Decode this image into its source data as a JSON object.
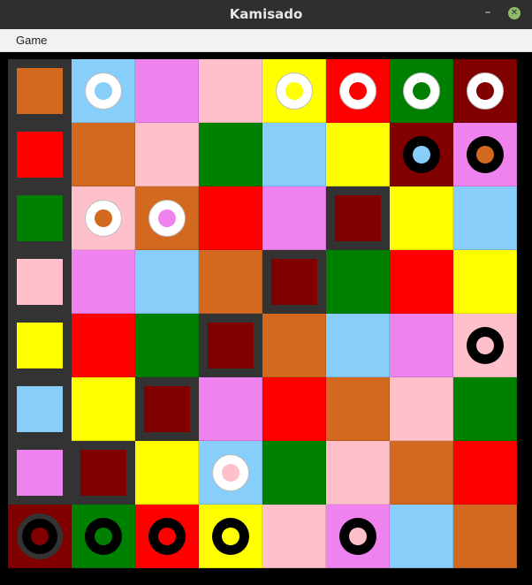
{
  "window": {
    "title": "Kamisado"
  },
  "titlebar": {
    "minimize_glyph": "–",
    "close_glyph": "✕"
  },
  "menu": {
    "items": [
      "Game"
    ]
  },
  "colors": {
    "orange": "#d2691e",
    "blue": "#87cefa",
    "violet": "#ee82ee",
    "pink": "#ffc0cb",
    "yellow": "#ffff00",
    "red": "#ff0000",
    "green": "#008000",
    "brown": "#800000",
    "frame": "#333333"
  },
  "board": {
    "rows": [
      [
        "orange",
        "blue",
        "violet",
        "pink",
        "yellow",
        "red",
        "green",
        "brown"
      ],
      [
        "red",
        "orange",
        "pink",
        "green",
        "blue",
        "yellow",
        "brown",
        "violet"
      ],
      [
        "green",
        "pink",
        "orange",
        "red",
        "violet",
        "brown",
        "yellow",
        "blue"
      ],
      [
        "pink",
        "violet",
        "blue",
        "orange",
        "brown",
        "green",
        "red",
        "yellow"
      ],
      [
        "yellow",
        "red",
        "green",
        "brown",
        "orange",
        "blue",
        "violet",
        "pink"
      ],
      [
        "blue",
        "yellow",
        "brown",
        "violet",
        "red",
        "orange",
        "pink",
        "green"
      ],
      [
        "violet",
        "brown",
        "yellow",
        "blue",
        "green",
        "pink",
        "orange",
        "red"
      ],
      [
        "brown",
        "green",
        "red",
        "yellow",
        "pink",
        "violet",
        "blue",
        "orange"
      ]
    ],
    "highlighted": [
      [
        0,
        0
      ],
      [
        1,
        0
      ],
      [
        2,
        0
      ],
      [
        3,
        0
      ],
      [
        4,
        0
      ],
      [
        5,
        0
      ],
      [
        6,
        0
      ],
      [
        2,
        5
      ],
      [
        3,
        4
      ],
      [
        4,
        3
      ],
      [
        5,
        2
      ],
      [
        6,
        1
      ]
    ],
    "pieces": [
      {
        "row": 0,
        "col": 1,
        "player": "white",
        "color": "blue"
      },
      {
        "row": 0,
        "col": 4,
        "player": "white",
        "color": "yellow"
      },
      {
        "row": 0,
        "col": 5,
        "player": "white",
        "color": "red"
      },
      {
        "row": 0,
        "col": 6,
        "player": "white",
        "color": "green"
      },
      {
        "row": 0,
        "col": 7,
        "player": "white",
        "color": "brown"
      },
      {
        "row": 1,
        "col": 6,
        "player": "black",
        "color": "blue"
      },
      {
        "row": 1,
        "col": 7,
        "player": "black",
        "color": "orange"
      },
      {
        "row": 2,
        "col": 1,
        "player": "white",
        "color": "orange"
      },
      {
        "row": 2,
        "col": 2,
        "player": "white",
        "color": "violet"
      },
      {
        "row": 4,
        "col": 7,
        "player": "black",
        "color": "pink"
      },
      {
        "row": 6,
        "col": 3,
        "player": "white",
        "color": "pink"
      },
      {
        "row": 7,
        "col": 0,
        "player": "black",
        "color": "brown",
        "selected": true
      },
      {
        "row": 7,
        "col": 1,
        "player": "black",
        "color": "green"
      },
      {
        "row": 7,
        "col": 2,
        "player": "black",
        "color": "red"
      },
      {
        "row": 7,
        "col": 3,
        "player": "black",
        "color": "yellow"
      },
      {
        "row": 7,
        "col": 5,
        "player": "black",
        "color": "pink"
      }
    ]
  }
}
